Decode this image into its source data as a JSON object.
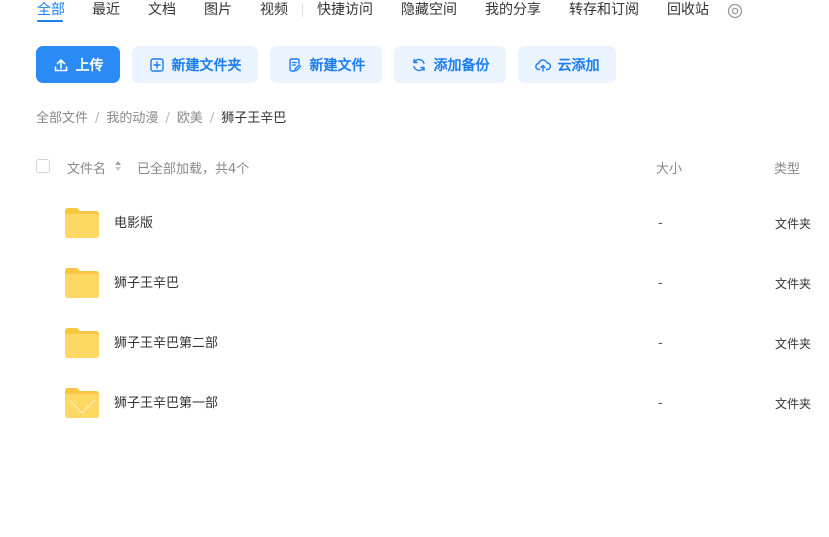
{
  "tabs": [
    {
      "label": "全部",
      "active": true
    },
    {
      "label": "最近"
    },
    {
      "label": "文档"
    },
    {
      "label": "图片"
    },
    {
      "label": "视频"
    },
    {
      "label": "快捷访问"
    },
    {
      "label": "隐藏空间"
    },
    {
      "label": "我的分享"
    },
    {
      "label": "转存和订阅"
    },
    {
      "label": "回收站"
    }
  ],
  "settings_icon": "settings-icon",
  "toolbar": {
    "upload_label": "上传",
    "new_folder_label": "新建文件夹",
    "new_file_label": "新建文件",
    "add_backup_label": "添加备份",
    "cloud_add_label": "云添加"
  },
  "breadcrumb": [
    "全部文件",
    "我的动漫",
    "欧美",
    "狮子王辛巴"
  ],
  "breadcrumb_separator": "/",
  "list_header": {
    "name": "文件名",
    "loaded_status": "已全部加载，共4个",
    "size": "大小",
    "type": "类型"
  },
  "files": [
    {
      "name": "电影版",
      "size": "-",
      "type": "文件夹",
      "icon": "folder-icon"
    },
    {
      "name": "狮子王辛巴",
      "size": "-",
      "type": "文件夹",
      "icon": "folder-icon"
    },
    {
      "name": "狮子王辛巴第二部",
      "size": "-",
      "type": "文件夹",
      "icon": "folder-icon"
    },
    {
      "name": "狮子王辛巴第一部",
      "size": "-",
      "type": "文件夹",
      "icon": "folder-icon"
    }
  ],
  "colors": {
    "accent": "#1a7df2",
    "primary_button": "#2a8af6",
    "secondary_button_bg": "#eaf3fe",
    "folder": "#fcd45c"
  }
}
